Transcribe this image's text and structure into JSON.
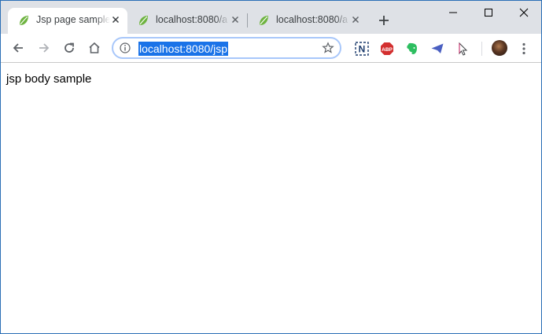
{
  "tabs": [
    {
      "title": "Jsp page sample",
      "active": true
    },
    {
      "title": "localhost:8080/a",
      "active": false
    },
    {
      "title": "localhost:8080/a",
      "active": false
    }
  ],
  "address_bar": {
    "url": "localhost:8080/jsp"
  },
  "page": {
    "body_text": "jsp body sample"
  },
  "extensions": [
    {
      "name": "n-extension-icon",
      "label": "N"
    },
    {
      "name": "adblock-plus-icon",
      "label": "ABP"
    },
    {
      "name": "evernote-icon"
    },
    {
      "name": "send-paper-plane-icon"
    },
    {
      "name": "cursor-arrow-icon"
    }
  ],
  "icons": {
    "back": "arrow-left-icon",
    "forward": "arrow-right-icon",
    "reload": "reload-icon",
    "home": "home-icon",
    "info": "info-icon",
    "bookmark": "star-icon",
    "menu": "three-dots-menu-icon",
    "favicon": "spring-leaf-icon"
  },
  "colors": {
    "tabstrip_bg": "#dee1e6",
    "selection": "#1a73e8",
    "omnibox_border": "#a8c7fa",
    "window_border": "#2b6fb6"
  }
}
